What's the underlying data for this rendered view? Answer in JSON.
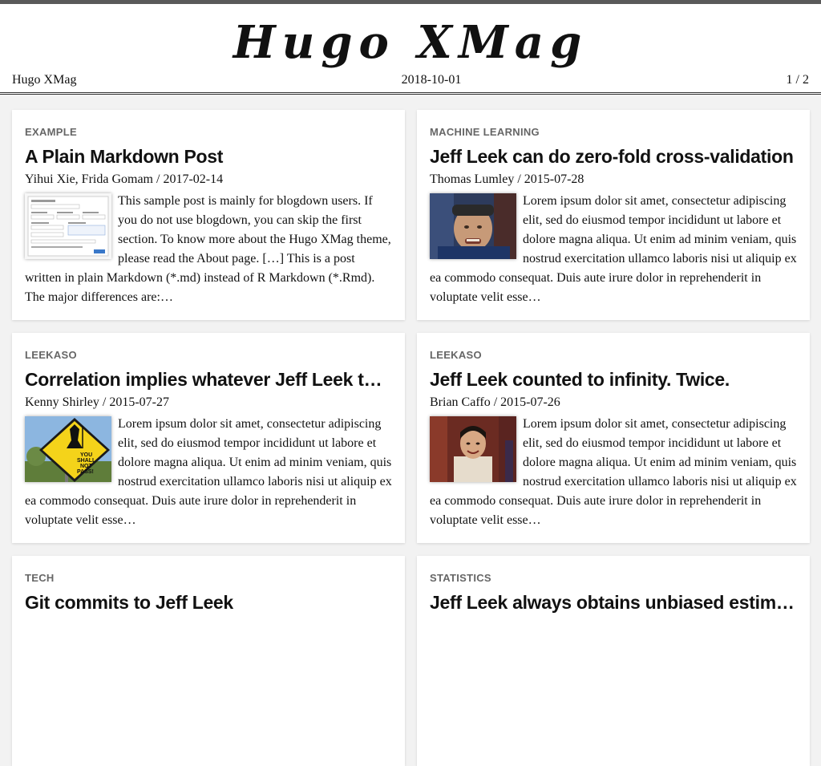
{
  "site": {
    "title": "Hugo XMag",
    "name": "Hugo XMag",
    "date": "2018-10-01",
    "pagination": "1 / 2"
  },
  "posts": [
    {
      "category": "EXAMPLE",
      "title": "A Plain Markdown Post",
      "authors": "Yihui Xie, Frida Gomam",
      "date": "2017-02-14",
      "excerpt": "This sample post is mainly for blogdown users. If you do not use blogdown, you can skip the first section. To know more about the Hugo XMag theme, please read the About page. […] This is a post written in plain Markdown (*.md) instead of R Markdown (*.Rmd). The major differences are:…",
      "thumbnail": "form-screenshot-thumbnail"
    },
    {
      "category": "MACHINE LEARNING",
      "title": "Jeff Leek can do zero-fold cross-validation",
      "authors": "Thomas Lumley",
      "date": "2015-07-28",
      "excerpt": "Lorem ipsum dolor sit amet, consectetur adipiscing elit, sed do eiusmod tempor incididunt ut labore et dolore magna aliqua. Ut enim ad minim veniam, quis nostrud exercitation ullamco laboris nisi ut aliquip ex ea commodo consequat. Duis aute irure dolor in reprehenderit in voluptate velit esse…",
      "thumbnail": "photo-thumbnail"
    },
    {
      "category": "LEEKASO",
      "title": "Correlation implies whatever Jeff Leek tells it to",
      "authors": "Kenny Shirley",
      "date": "2015-07-27",
      "excerpt": "Lorem ipsum dolor sit amet, consectetur adipiscing elit, sed do eiusmod tempor incididunt ut labore et dolore magna aliqua. Ut enim ad minim veniam, quis nostrud exercitation ullamco laboris nisi ut aliquip ex ea commodo consequat. Duis aute irure dolor in reprehenderit in voluptate velit esse…",
      "thumbnail": "sign-thumbnail",
      "sign_text": [
        "YOU",
        "SHALL",
        "NOT",
        "PASS!"
      ]
    },
    {
      "category": "LEEKASO",
      "title": "Jeff Leek counted to infinity. Twice.",
      "authors": "Brian Caffo",
      "date": "2015-07-26",
      "excerpt": "Lorem ipsum dolor sit amet, consectetur adipiscing elit, sed do eiusmod tempor incididunt ut labore et dolore magna aliqua. Ut enim ad minim veniam, quis nostrud exercitation ullamco laboris nisi ut aliquip ex ea commodo consequat. Duis aute irure dolor in reprehenderit in voluptate velit esse…",
      "thumbnail": "photo-thumbnail"
    },
    {
      "category": "TECH",
      "title": "Git commits to Jeff Leek",
      "authors": "",
      "date": "",
      "excerpt": ""
    },
    {
      "category": "STATISTICS",
      "title": "Jeff Leek always obtains unbiased estimates",
      "authors": "",
      "date": "",
      "excerpt": ""
    }
  ],
  "colors": {
    "top_bar": "#5a5a5a",
    "background": "#f2f2f2",
    "card": "#ffffff",
    "category": "#666666",
    "sign_yellow": "#f4d31a"
  }
}
